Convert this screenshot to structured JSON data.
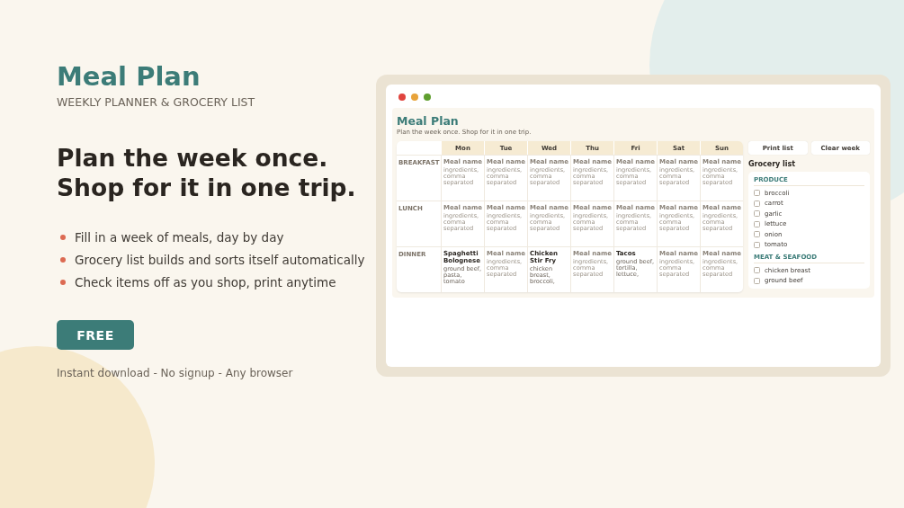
{
  "hero": {
    "title": "Meal Plan",
    "subtitle": "WEEKLY PLANNER & GROCERY LIST",
    "headline": [
      "Plan the week once.",
      "Shop for it in one trip."
    ],
    "bullets": [
      "Fill in a week of meals, day by day",
      "Grocery list builds and sorts itself automatically",
      "Check items off as you shop, print anytime"
    ],
    "cta": "FREE",
    "footnote": "Instant download - No signup - Any browser"
  },
  "mockup": {
    "app_title": "Meal Plan",
    "app_subtitle": "Plan the week once. Shop for it in one trip.",
    "days": [
      "Mon",
      "Tue",
      "Wed",
      "Thu",
      "Fri",
      "Sat",
      "Sun"
    ],
    "meals": [
      {
        "label": "BREAKFAST",
        "cells": [
          {
            "name": {
              "placeholder": "Meal name"
            },
            "ingredients": {
              "placeholder": "ingredients, comma separated"
            }
          },
          {
            "name": {
              "placeholder": "Meal name"
            },
            "ingredients": {
              "placeholder": "ingredients, comma separated"
            }
          },
          {
            "name": {
              "placeholder": "Meal name"
            },
            "ingredients": {
              "placeholder": "ingredients, comma separated"
            }
          },
          {
            "name": {
              "placeholder": "Meal name"
            },
            "ingredients": {
              "placeholder": "ingredients, comma separated"
            }
          },
          {
            "name": {
              "placeholder": "Meal name"
            },
            "ingredients": {
              "placeholder": "ingredients, comma separated"
            }
          },
          {
            "name": {
              "placeholder": "Meal name"
            },
            "ingredients": {
              "placeholder": "ingredients, comma separated"
            }
          },
          {
            "name": {
              "placeholder": "Meal name"
            },
            "ingredients": {
              "placeholder": "ingredients, comma separated"
            }
          }
        ]
      },
      {
        "label": "LUNCH",
        "cells": [
          {
            "name": {
              "placeholder": "Meal name"
            },
            "ingredients": {
              "placeholder": "ingredients, comma separated"
            }
          },
          {
            "name": {
              "placeholder": "Meal name"
            },
            "ingredients": {
              "placeholder": "ingredients, comma separated"
            }
          },
          {
            "name": {
              "placeholder": "Meal name"
            },
            "ingredients": {
              "placeholder": "ingredients, comma separated"
            }
          },
          {
            "name": {
              "placeholder": "Meal name"
            },
            "ingredients": {
              "placeholder": "ingredients, comma separated"
            }
          },
          {
            "name": {
              "placeholder": "Meal name"
            },
            "ingredients": {
              "placeholder": "ingredients, comma separated"
            }
          },
          {
            "name": {
              "placeholder": "Meal name"
            },
            "ingredients": {
              "placeholder": "ingredients, comma separated"
            }
          },
          {
            "name": {
              "placeholder": "Meal name"
            },
            "ingredients": {
              "placeholder": "ingredients, comma separated"
            }
          }
        ]
      },
      {
        "label": "DINNER",
        "cells": [
          {
            "name": {
              "value": "Spaghetti Bolognese"
            },
            "ingredients": {
              "value": "ground beef, pasta, tomato"
            }
          },
          {
            "name": {
              "placeholder": "Meal name"
            },
            "ingredients": {
              "placeholder": "ingredients, comma separated"
            }
          },
          {
            "name": {
              "value": "Chicken Stir Fry"
            },
            "ingredients": {
              "value": "chicken breast, broccoli,"
            }
          },
          {
            "name": {
              "placeholder": "Meal name"
            },
            "ingredients": {
              "placeholder": "ingredients, comma separated"
            }
          },
          {
            "name": {
              "value": "Tacos"
            },
            "ingredients": {
              "value": "ground beef, tortilla, lettuce,"
            }
          },
          {
            "name": {
              "placeholder": "Meal name"
            },
            "ingredients": {
              "placeholder": "ingredients, comma separated"
            }
          },
          {
            "name": {
              "placeholder": "Meal name"
            },
            "ingredients": {
              "placeholder": "ingredients, comma separated"
            }
          }
        ]
      }
    ],
    "buttons": [
      "Print list",
      "Clear week"
    ],
    "grocery_title": "Grocery list",
    "grocery": [
      {
        "category": "PRODUCE",
        "items": [
          {
            "label": "broccoli",
            "checked": false
          },
          {
            "label": "carrot",
            "checked": false
          },
          {
            "label": "garlic",
            "checked": false
          },
          {
            "label": "lettuce",
            "checked": false
          },
          {
            "label": "onion",
            "checked": false
          },
          {
            "label": "tomato",
            "checked": false
          }
        ]
      },
      {
        "category": "MEAT & SEAFOOD",
        "items": [
          {
            "label": "chicken breast",
            "checked": false
          },
          {
            "label": "ground beef",
            "checked": false
          }
        ]
      }
    ]
  }
}
